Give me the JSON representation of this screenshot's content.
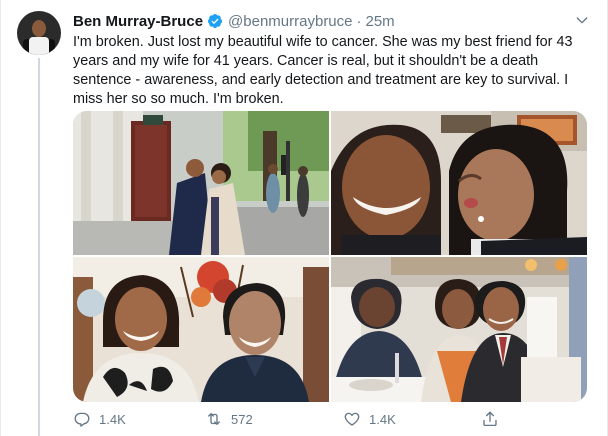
{
  "author": {
    "display_name": "Ben Murray-Bruce",
    "handle": "@benmurraybruce",
    "separator": "·",
    "time": "25m",
    "verified": true
  },
  "tweet": {
    "text": "I'm broken. Just lost my beautiful wife to cancer. She was my best friend for 43 years and my wife for 41 years. Cancer is real, but it shouldn't be a death sentence - awareness, and early detection and treatment are key to survival. I miss her so so much. I'm broken."
  },
  "media": {
    "photos": [
      "street-kiss-photo",
      "cheek-kiss-closeup-photo",
      "couple-seated-indoors-photo",
      "couple-at-dinner-photo"
    ]
  },
  "actions": {
    "replies": "1.4K",
    "retweets": "572",
    "likes": "1.4K"
  },
  "colors": {
    "text": "#14171a",
    "muted": "#657786",
    "verified": "#1da1f2",
    "border": "#e6ecf0"
  }
}
